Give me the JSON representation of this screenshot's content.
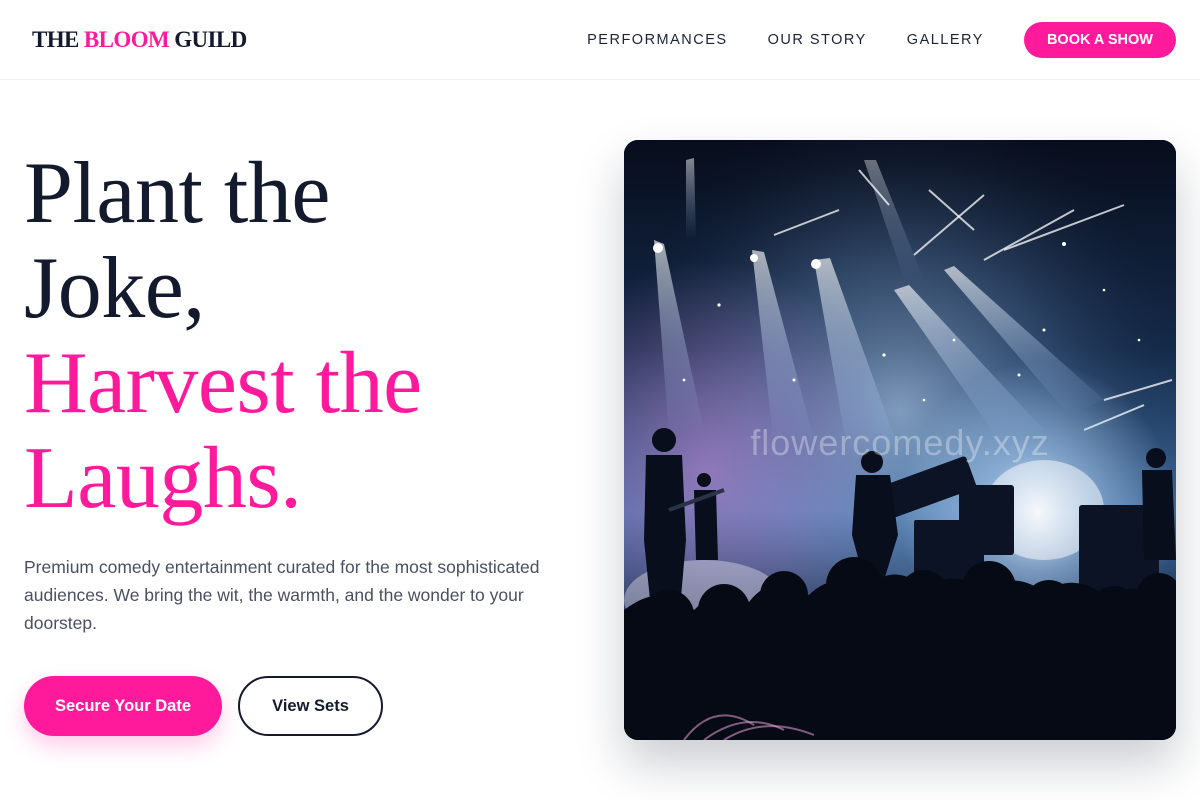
{
  "header": {
    "logo": {
      "part1": "THE ",
      "accent": "BLOOM",
      "part2": " GUILD"
    },
    "nav": [
      {
        "label": "PERFORMANCES"
      },
      {
        "label": "OUR STORY"
      },
      {
        "label": "GALLERY"
      }
    ],
    "cta_label": "BOOK A SHOW"
  },
  "hero": {
    "headline": {
      "line1": "Plant the",
      "line2": "Joke,",
      "line3": "Harvest the",
      "line4": "Laughs."
    },
    "subcopy": "Premium comedy entertainment curated for the most sophisticated audiences. We bring the wit, the warmth, and the wonder to your doorstep.",
    "primary_cta": "Secure Your Date",
    "secondary_cta": "View Sets",
    "image": {
      "watermark": "flowercomedy.xyz",
      "description_icon": "concert-stage-photo"
    }
  },
  "colors": {
    "accent": "#ff1a9c",
    "ink": "#141a2e",
    "body_text": "#4a5060"
  }
}
